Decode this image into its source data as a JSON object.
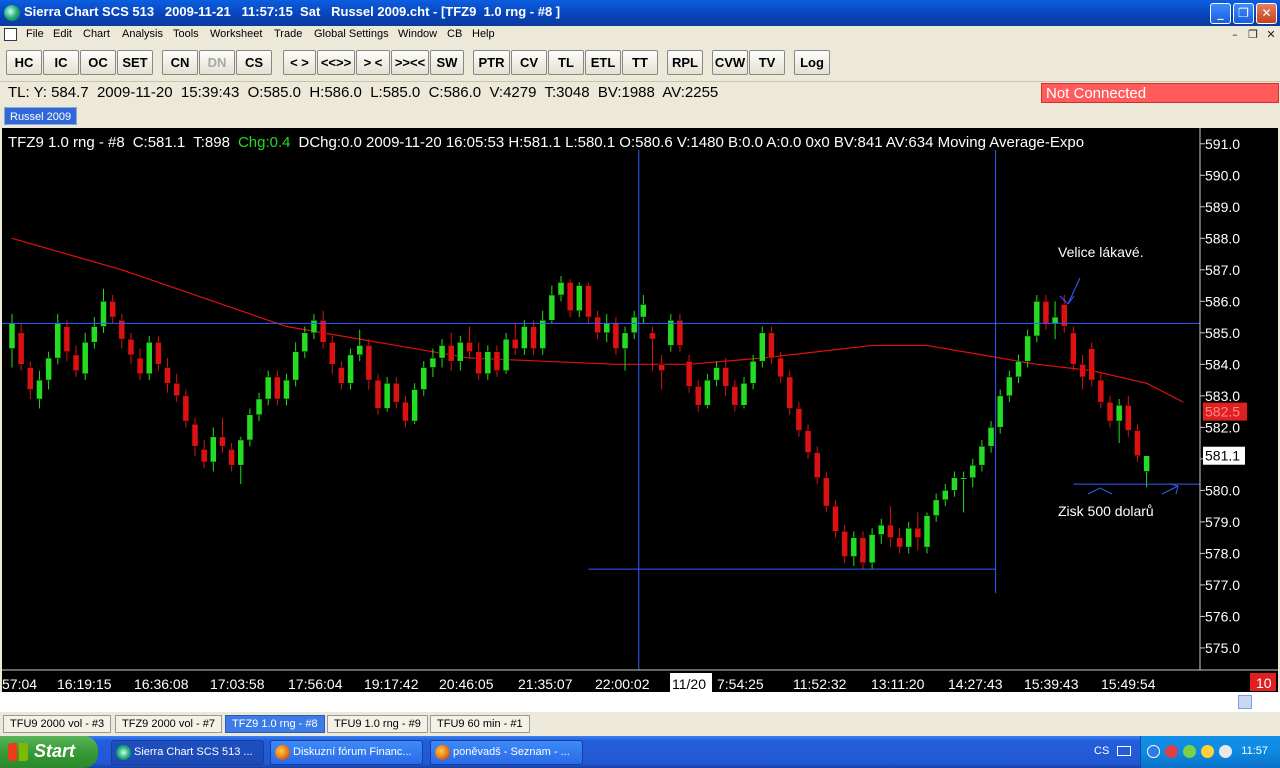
{
  "window": {
    "title": "Sierra Chart SCS 513   2009-11-21   11:57:15  Sat   Russel 2009.cht - [TFZ9  1.0 rng - #8 ]",
    "min": "_",
    "max": "❐",
    "close": "✕"
  },
  "menu": [
    "File",
    "Edit",
    "Chart",
    "Analysis",
    "Tools",
    "Worksheet",
    "Trade",
    "Global Settings",
    "Window",
    "CB",
    "Help"
  ],
  "mdi_controls": [
    "–",
    "❐",
    "✕"
  ],
  "toolbar": [
    "HC",
    "IC",
    "OC",
    "SET",
    "CN",
    "DN",
    "CS",
    "< >",
    "<<>>",
    "> <",
    ">><<",
    "SW",
    "PTR",
    "CV",
    "TL",
    "ETL",
    "TT",
    "RPL",
    "CVW",
    "TV",
    "Log"
  ],
  "tl_info": "TL: Y: 584.7  2009-11-20  15:39:43  O:585.0  H:586.0  L:585.0  C:586.0  V:4279  T:3048  BV:1988  AV:2255",
  "connection_status": "Not Connected",
  "chartbook_tab": "Russel 2009",
  "chart_header": {
    "symbol": "TFZ9  1.0 rng - #8",
    "close": "C:581.1",
    "trades": "T:898",
    "change": "Chg:0.4",
    "rest": "DChg:0.0  2009-11-20  16:05:53  H:581.1  L:580.1  O:580.6  V:1480  B:0.0  A:0.0  0x0    BV:841  AV:634  Moving Average-Expo"
  },
  "annotations": {
    "top": "Velice lákavé.",
    "bottom": "Zisk 500 dolarů"
  },
  "colors": {
    "background": "#000000",
    "up": "#22dd22",
    "down": "#dd1111",
    "moving_average": "#e01010",
    "crosshair": "#3060ff",
    "label_red": "#e02020"
  },
  "chart_data": {
    "type": "candlestick",
    "ylim": [
      574.3,
      591.5
    ],
    "y_ticks": [
      "591.0",
      "590.0",
      "589.0",
      "588.0",
      "587.0",
      "586.0",
      "585.0",
      "584.0",
      "583.0",
      "582.0",
      "581.0",
      "580.0",
      "579.0",
      "578.0",
      "577.0",
      "576.0",
      "575.0"
    ],
    "x_labels": [
      "57:04",
      "16:19:15",
      "16:36:08",
      "17:03:58",
      "17:56:04",
      "19:17:42",
      "20:46:05",
      "21:35:07",
      "22:00:02",
      "11/20",
      "7:54:25",
      "11:52:32",
      "13:11:20",
      "14:27:43",
      "15:39:43",
      "15:49:54"
    ],
    "last_price": "581.1",
    "ma_value": "582.5",
    "corner_value": "10",
    "crosshair_price": 585.3,
    "bars": [
      {
        "o": 584.5,
        "c": 585.3,
        "h": 585.6,
        "l": 583.9
      },
      {
        "o": 585.0,
        "c": 584.0,
        "h": 585.3,
        "l": 583.8
      },
      {
        "o": 583.9,
        "c": 583.2,
        "h": 584.1,
        "l": 582.9
      },
      {
        "o": 582.9,
        "c": 583.5,
        "h": 583.8,
        "l": 582.6
      },
      {
        "o": 583.5,
        "c": 584.2,
        "h": 584.4,
        "l": 583.2
      },
      {
        "o": 584.2,
        "c": 585.3,
        "h": 585.6,
        "l": 584.0
      },
      {
        "o": 585.2,
        "c": 584.4,
        "h": 585.4,
        "l": 584.1
      },
      {
        "o": 584.3,
        "c": 583.8,
        "h": 584.6,
        "l": 583.6
      },
      {
        "o": 583.7,
        "c": 584.7,
        "h": 585.0,
        "l": 583.5
      },
      {
        "o": 584.7,
        "c": 585.2,
        "h": 585.5,
        "l": 584.5
      },
      {
        "o": 585.2,
        "c": 586.0,
        "h": 586.4,
        "l": 585.0
      },
      {
        "o": 586.0,
        "c": 585.5,
        "h": 586.2,
        "l": 585.3
      },
      {
        "o": 585.4,
        "c": 584.8,
        "h": 585.6,
        "l": 584.5
      },
      {
        "o": 584.8,
        "c": 584.3,
        "h": 585.0,
        "l": 584.0
      },
      {
        "o": 584.2,
        "c": 583.7,
        "h": 584.5,
        "l": 583.5
      },
      {
        "o": 583.7,
        "c": 584.7,
        "h": 584.9,
        "l": 583.5
      },
      {
        "o": 584.7,
        "c": 584.0,
        "h": 584.9,
        "l": 583.8
      },
      {
        "o": 583.9,
        "c": 583.4,
        "h": 584.2,
        "l": 583.1
      },
      {
        "o": 583.4,
        "c": 583.0,
        "h": 583.7,
        "l": 582.8
      },
      {
        "o": 583.0,
        "c": 582.2,
        "h": 583.2,
        "l": 582.0
      },
      {
        "o": 582.1,
        "c": 581.4,
        "h": 582.3,
        "l": 581.1
      },
      {
        "o": 581.3,
        "c": 580.9,
        "h": 581.6,
        "l": 580.7
      },
      {
        "o": 580.9,
        "c": 581.7,
        "h": 582.0,
        "l": 580.6
      },
      {
        "o": 581.7,
        "c": 581.4,
        "h": 582.3,
        "l": 581.2
      },
      {
        "o": 581.3,
        "c": 580.8,
        "h": 581.5,
        "l": 580.6
      },
      {
        "o": 580.8,
        "c": 581.6,
        "h": 581.7,
        "l": 580.2
      },
      {
        "o": 581.6,
        "c": 582.4,
        "h": 582.6,
        "l": 581.4
      },
      {
        "o": 582.4,
        "c": 582.9,
        "h": 583.1,
        "l": 582.2
      },
      {
        "o": 582.9,
        "c": 583.6,
        "h": 583.8,
        "l": 582.7
      },
      {
        "o": 583.6,
        "c": 582.9,
        "h": 583.8,
        "l": 582.7
      },
      {
        "o": 582.9,
        "c": 583.5,
        "h": 583.7,
        "l": 582.7
      },
      {
        "o": 583.5,
        "c": 584.4,
        "h": 584.7,
        "l": 583.3
      },
      {
        "o": 584.4,
        "c": 585.0,
        "h": 585.2,
        "l": 584.2
      },
      {
        "o": 585.0,
        "c": 585.4,
        "h": 585.6,
        "l": 584.8
      },
      {
        "o": 585.4,
        "c": 584.7,
        "h": 585.7,
        "l": 584.5
      },
      {
        "o": 584.7,
        "c": 584.0,
        "h": 584.9,
        "l": 583.7
      },
      {
        "o": 583.9,
        "c": 583.4,
        "h": 584.1,
        "l": 583.2
      },
      {
        "o": 583.4,
        "c": 584.3,
        "h": 584.5,
        "l": 583.2
      },
      {
        "o": 584.3,
        "c": 584.6,
        "h": 585.1,
        "l": 584.1
      },
      {
        "o": 584.6,
        "c": 583.5,
        "h": 584.8,
        "l": 583.2
      },
      {
        "o": 583.5,
        "c": 582.6,
        "h": 583.7,
        "l": 582.4
      },
      {
        "o": 582.6,
        "c": 583.4,
        "h": 583.6,
        "l": 582.5
      },
      {
        "o": 583.4,
        "c": 582.8,
        "h": 583.6,
        "l": 582.6
      },
      {
        "o": 582.8,
        "c": 582.2,
        "h": 583.0,
        "l": 582.0
      },
      {
        "o": 582.2,
        "c": 583.2,
        "h": 583.4,
        "l": 582.1
      },
      {
        "o": 583.2,
        "c": 583.9,
        "h": 584.1,
        "l": 583.0
      },
      {
        "o": 583.9,
        "c": 584.2,
        "h": 584.5,
        "l": 583.6
      },
      {
        "o": 584.2,
        "c": 584.6,
        "h": 584.8,
        "l": 583.9
      },
      {
        "o": 584.6,
        "c": 584.1,
        "h": 585.0,
        "l": 583.8
      },
      {
        "o": 584.1,
        "c": 584.7,
        "h": 584.9,
        "l": 583.8
      },
      {
        "o": 584.7,
        "c": 584.4,
        "h": 585.2,
        "l": 584.2
      },
      {
        "o": 584.4,
        "c": 583.7,
        "h": 584.7,
        "l": 583.5
      },
      {
        "o": 583.7,
        "c": 584.4,
        "h": 584.6,
        "l": 583.5
      },
      {
        "o": 584.4,
        "c": 583.8,
        "h": 584.6,
        "l": 583.6
      },
      {
        "o": 583.8,
        "c": 584.8,
        "h": 585.0,
        "l": 583.7
      },
      {
        "o": 584.8,
        "c": 584.5,
        "h": 585.3,
        "l": 584.3
      },
      {
        "o": 584.5,
        "c": 585.2,
        "h": 585.4,
        "l": 584.3
      },
      {
        "o": 585.2,
        "c": 584.5,
        "h": 585.4,
        "l": 584.3
      },
      {
        "o": 584.5,
        "c": 585.4,
        "h": 585.7,
        "l": 584.3
      },
      {
        "o": 585.4,
        "c": 586.2,
        "h": 586.5,
        "l": 585.3
      },
      {
        "o": 586.2,
        "c": 586.6,
        "h": 586.8,
        "l": 586.0
      },
      {
        "o": 586.6,
        "c": 585.7,
        "h": 586.7,
        "l": 585.5
      },
      {
        "o": 585.7,
        "c": 586.5,
        "h": 586.6,
        "l": 585.5
      },
      {
        "o": 586.5,
        "c": 585.5,
        "h": 586.6,
        "l": 585.3
      },
      {
        "o": 585.5,
        "c": 585.0,
        "h": 585.7,
        "l": 584.8
      },
      {
        "o": 585.0,
        "c": 585.3,
        "h": 585.6,
        "l": 584.7
      },
      {
        "o": 585.3,
        "c": 584.5,
        "h": 585.5,
        "l": 584.3
      },
      {
        "o": 584.5,
        "c": 585.0,
        "h": 585.2,
        "l": 583.8
      },
      {
        "o": 585.0,
        "c": 585.5,
        "h": 585.7,
        "l": 584.8
      },
      {
        "o": 585.5,
        "c": 585.9,
        "h": 586.2,
        "l": 585.3
      },
      {
        "o": 585.0,
        "c": 584.8,
        "h": 585.2,
        "l": 583.8
      },
      {
        "o": 584.0,
        "c": 583.8,
        "h": 584.3,
        "l": 583.2
      },
      {
        "o": 584.6,
        "c": 585.4,
        "h": 585.6,
        "l": 584.4
      },
      {
        "o": 585.4,
        "c": 584.6,
        "h": 585.6,
        "l": 584.4
      },
      {
        "o": 584.1,
        "c": 583.3,
        "h": 584.3,
        "l": 583.1
      },
      {
        "o": 583.3,
        "c": 582.7,
        "h": 583.5,
        "l": 582.5
      },
      {
        "o": 582.7,
        "c": 583.5,
        "h": 583.7,
        "l": 582.6
      },
      {
        "o": 583.5,
        "c": 583.9,
        "h": 584.1,
        "l": 583.3
      },
      {
        "o": 583.9,
        "c": 583.3,
        "h": 584.2,
        "l": 583.0
      },
      {
        "o": 583.3,
        "c": 582.7,
        "h": 583.5,
        "l": 582.5
      },
      {
        "o": 582.7,
        "c": 583.4,
        "h": 583.6,
        "l": 582.6
      },
      {
        "o": 583.4,
        "c": 584.1,
        "h": 584.3,
        "l": 583.2
      },
      {
        "o": 584.1,
        "c": 585.0,
        "h": 585.2,
        "l": 583.9
      },
      {
        "o": 585.0,
        "c": 584.2,
        "h": 585.2,
        "l": 584.0
      },
      {
        "o": 584.2,
        "c": 583.6,
        "h": 584.4,
        "l": 583.4
      },
      {
        "o": 583.6,
        "c": 582.6,
        "h": 583.8,
        "l": 582.4
      },
      {
        "o": 582.6,
        "c": 581.9,
        "h": 582.8,
        "l": 581.7
      },
      {
        "o": 581.9,
        "c": 581.2,
        "h": 582.1,
        "l": 581.0
      },
      {
        "o": 581.2,
        "c": 580.4,
        "h": 581.4,
        "l": 580.2
      },
      {
        "o": 580.4,
        "c": 579.5,
        "h": 580.6,
        "l": 579.3
      },
      {
        "o": 579.5,
        "c": 578.7,
        "h": 579.7,
        "l": 578.5
      },
      {
        "o": 578.7,
        "c": 577.9,
        "h": 578.9,
        "l": 577.7
      },
      {
        "o": 577.9,
        "c": 578.5,
        "h": 578.7,
        "l": 577.6
      },
      {
        "o": 578.5,
        "c": 577.7,
        "h": 578.7,
        "l": 577.5
      },
      {
        "o": 577.7,
        "c": 578.6,
        "h": 578.8,
        "l": 577.5
      },
      {
        "o": 578.6,
        "c": 578.9,
        "h": 579.1,
        "l": 578.3
      },
      {
        "o": 578.9,
        "c": 578.5,
        "h": 579.5,
        "l": 578.2
      },
      {
        "o": 578.5,
        "c": 578.2,
        "h": 578.8,
        "l": 578.0
      },
      {
        "o": 578.2,
        "c": 578.8,
        "h": 579.0,
        "l": 578.0
      },
      {
        "o": 578.8,
        "c": 578.5,
        "h": 579.3,
        "l": 578.1
      },
      {
        "o": 578.2,
        "c": 579.2,
        "h": 579.3,
        "l": 578.0
      },
      {
        "o": 579.2,
        "c": 579.7,
        "h": 579.9,
        "l": 579.0
      },
      {
        "o": 579.7,
        "c": 580.0,
        "h": 580.2,
        "l": 579.5
      },
      {
        "o": 580.0,
        "c": 580.4,
        "h": 580.6,
        "l": 579.8
      },
      {
        "o": 580.4,
        "c": 580.4,
        "h": 580.6,
        "l": 579.3
      },
      {
        "o": 580.4,
        "c": 580.8,
        "h": 581.0,
        "l": 580.1
      },
      {
        "o": 580.8,
        "c": 581.4,
        "h": 581.6,
        "l": 580.6
      },
      {
        "o": 581.4,
        "c": 582.0,
        "h": 582.2,
        "l": 581.2
      },
      {
        "o": 582.0,
        "c": 583.0,
        "h": 583.2,
        "l": 581.8
      },
      {
        "o": 583.0,
        "c": 583.6,
        "h": 583.8,
        "l": 582.8
      },
      {
        "o": 583.6,
        "c": 584.1,
        "h": 584.3,
        "l": 583.4
      },
      {
        "o": 584.1,
        "c": 584.9,
        "h": 585.1,
        "l": 583.9
      },
      {
        "o": 584.9,
        "c": 586.0,
        "h": 586.2,
        "l": 584.7
      },
      {
        "o": 586.0,
        "c": 585.3,
        "h": 586.2,
        "l": 585.1
      },
      {
        "o": 585.3,
        "c": 585.5,
        "h": 586.0,
        "l": 584.8
      },
      {
        "o": 585.9,
        "c": 585.2,
        "h": 586.2,
        "l": 585.0
      },
      {
        "o": 585.0,
        "c": 584.0,
        "h": 585.2,
        "l": 583.8
      },
      {
        "o": 584.0,
        "c": 583.6,
        "h": 584.3,
        "l": 583.2
      },
      {
        "o": 584.5,
        "c": 583.5,
        "h": 584.7,
        "l": 583.3
      },
      {
        "o": 583.5,
        "c": 582.8,
        "h": 583.7,
        "l": 582.6
      },
      {
        "o": 582.8,
        "c": 582.2,
        "h": 583.0,
        "l": 582.0
      },
      {
        "o": 582.2,
        "c": 582.7,
        "h": 582.9,
        "l": 581.5
      },
      {
        "o": 582.7,
        "c": 581.9,
        "h": 583.0,
        "l": 581.7
      },
      {
        "o": 581.9,
        "c": 581.1,
        "h": 582.1,
        "l": 580.9
      },
      {
        "o": 580.6,
        "c": 581.1,
        "h": 581.1,
        "l": 580.1
      }
    ],
    "moving_average": [
      [
        0,
        588.0
      ],
      [
        6,
        587.5
      ],
      [
        12,
        587.0
      ],
      [
        18,
        586.4
      ],
      [
        24,
        585.8
      ],
      [
        30,
        585.2
      ],
      [
        36,
        584.9
      ],
      [
        42,
        584.6
      ],
      [
        50,
        584.2
      ],
      [
        58,
        584.1
      ],
      [
        66,
        584.0
      ],
      [
        74,
        584.0
      ],
      [
        82,
        584.2
      ],
      [
        88,
        584.4
      ],
      [
        94,
        584.6
      ],
      [
        100,
        584.6
      ],
      [
        106,
        584.3
      ],
      [
        112,
        584.0
      ],
      [
        118,
        583.8
      ],
      [
        124,
        583.4
      ],
      [
        128,
        582.8
      ]
    ],
    "vertical_lines_at_bar": [
      68.5,
      107.5
    ],
    "support_line": {
      "price": 577.5,
      "from_bar": 63,
      "to_bar": 107.5
    },
    "profit_line": {
      "price": 580.2,
      "from_bar": 116,
      "to_bar": 130
    }
  },
  "sheet_tabs": [
    "TFU9  2000 vol - #3",
    "TFZ9  2000 vol - #7",
    "TFZ9  1.0 rng - #8",
    "TFU9  1.0 rng - #9",
    "TFU9  60 min  - #1"
  ],
  "active_tab_index": 2,
  "taskbar": {
    "start": "Start",
    "tasks": [
      "Sierra Chart SCS 513 ...",
      "Diskuzní fórum Financ...",
      "poněvadš - Seznam - ..."
    ],
    "lang": "CS",
    "clock": "11:57"
  }
}
